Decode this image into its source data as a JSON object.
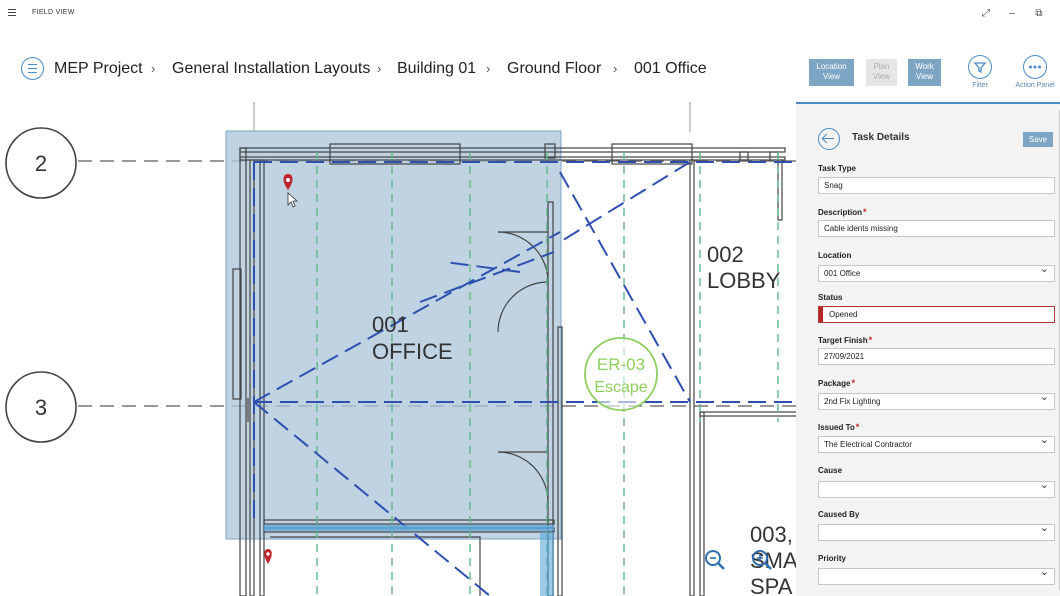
{
  "app": {
    "title": "FIELD VIEW"
  },
  "window": {
    "maximize": "⤢",
    "minimize": "–",
    "restore": "⧉"
  },
  "breadcrumb": [
    "MEP Project",
    "General Installation Layouts",
    "Building 01",
    "Ground Floor",
    "001 Office"
  ],
  "view_buttons": {
    "location": "Location View",
    "plan": "Plan View",
    "work": "Work View"
  },
  "tools": {
    "filter": "Filter",
    "action_panel": "Action Panel"
  },
  "drawing": {
    "grid_2": "2",
    "grid_3": "3",
    "room_001_number": "001",
    "room_001_name": "OFFICE",
    "room_002_number": "002",
    "room_002_name": "LOBBY",
    "room_003_number": "003,",
    "room_003_name": "SMA",
    "room_003_name2": "SPA",
    "stamp_code": "ER-03",
    "stamp_text": "Escape"
  },
  "panel": {
    "title": "Task Details",
    "save": "Save",
    "fields": {
      "task_type": {
        "label": "Task Type",
        "value": "Snag"
      },
      "description": {
        "label": "Description",
        "value": "Cable idents missing"
      },
      "location": {
        "label": "Location",
        "value": "001 Office"
      },
      "status": {
        "label": "Status",
        "value": "Opened"
      },
      "target_finish": {
        "label": "Target Finish",
        "value": "27/09/2021"
      },
      "package": {
        "label": "Package",
        "value": "2nd Fix Lighting"
      },
      "issued_to": {
        "label": "Issued To",
        "value": "The Electrical Contractor"
      },
      "cause": {
        "label": "Cause",
        "value": ""
      },
      "caused_by": {
        "label": "Caused By",
        "value": ""
      },
      "priority": {
        "label": "Priority",
        "value": ""
      }
    }
  },
  "colors": {
    "accent": "#4b8bc6",
    "button": "#7ea6c4",
    "status_open": "#b32727",
    "stamp": "#8fce5f",
    "selection": "#a9c4d8",
    "grid_green": "#5fb88a",
    "duct_blue": "#2d4fb0"
  }
}
